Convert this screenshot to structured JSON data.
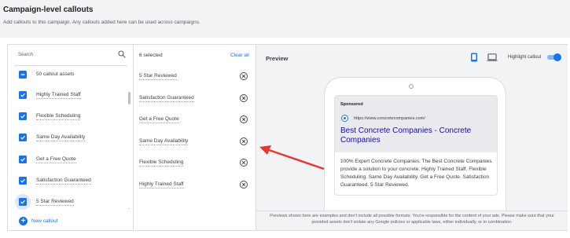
{
  "header": {
    "title": "Campaign-level callouts",
    "subtitle": "Add callouts to this campaign. Any callouts added here can be used across campaigns."
  },
  "left": {
    "search_label": "Search",
    "select_all_label": "50 callout assets",
    "items": [
      {
        "label": "Highly Trained Staff",
        "checked": true
      },
      {
        "label": "Flexible Scheduling",
        "checked": true
      },
      {
        "label": "Same Day Availability",
        "checked": true
      },
      {
        "label": "Get a Free Quote",
        "checked": true
      },
      {
        "label": "Satisfaction Guaranteed",
        "checked": true
      },
      {
        "label": "5 Star Reviewed",
        "checked": true
      }
    ],
    "new_callout_label": "New callout"
  },
  "middle": {
    "selected_count": "6 selected",
    "clear_all_label": "Clear all",
    "selected": [
      "5 Star Reviewed",
      "Satisfaction Guaranteed",
      "Get a Free Quote",
      "Same Day Availability",
      "Flexible Scheduling",
      "Highly Trained Staff"
    ]
  },
  "preview": {
    "title": "Preview",
    "highlight_label": "Highlight callout",
    "highlight_on": true,
    "ad": {
      "sponsored": "Sponsored",
      "url": "https://www.concretecompanies.com/",
      "headline": "Best Concrete Companies - Concrete Companies",
      "description": "100% Expert Concrete Companies. The Best Concrete Companies provide a solution to your concrete. Highly Trained Staff. Flexible Scheduling. Same Day Availability. Get a Free Quote. Satisfaction Guaranteed. 5 Star Reviewed."
    },
    "disclaimer": "Previews shown here are examples and don't include all possible formats. You're responsible for the content of your ads. Please make sure that your provided assets don't violate any Google policies or applicable laws, either individually, or in combination."
  },
  "colors": {
    "accent": "#1a73e8",
    "annotation_arrow": "#e53935"
  }
}
